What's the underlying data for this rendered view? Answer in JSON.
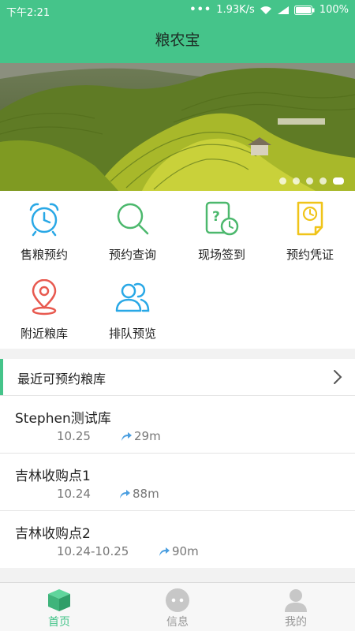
{
  "status": {
    "time": "下午2:21",
    "speed": "1.93K/s",
    "battery": "100%"
  },
  "header": {
    "title": "粮农宝"
  },
  "banner": {
    "pages": 5,
    "active_page": 5
  },
  "grid": [
    {
      "label": "售粮预约",
      "icon": "alarm-clock-icon",
      "color": "#29a8e6"
    },
    {
      "label": "预约查询",
      "icon": "search-icon",
      "color": "#4cb86d"
    },
    {
      "label": "现场签到",
      "icon": "checkin-clock-icon",
      "color": "#4cb86d"
    },
    {
      "label": "预约凭证",
      "icon": "voucher-icon",
      "color": "#f0c419"
    },
    {
      "label": "附近粮库",
      "icon": "location-pin-icon",
      "color": "#e8594f"
    },
    {
      "label": "排队预览",
      "icon": "people-icon",
      "color": "#29a8e6"
    }
  ],
  "nearby": {
    "header": "最近可预约粮库",
    "items": [
      {
        "name": "Stephen测试库",
        "date": "10.25",
        "distance": "29m"
      },
      {
        "name": "吉林收购点1",
        "date": "10.24",
        "distance": "88m"
      },
      {
        "name": "吉林收购点2",
        "date": "10.24-10.25",
        "distance": "90m"
      }
    ]
  },
  "nav": [
    {
      "label": "首页",
      "icon": "home-box-icon",
      "active": true
    },
    {
      "label": "信息",
      "icon": "message-icon",
      "active": false
    },
    {
      "label": "我的",
      "icon": "user-icon",
      "active": false
    }
  ],
  "colors": {
    "primary": "#45c48a",
    "blue": "#29a8e6",
    "green": "#4cb86d",
    "yellow": "#f0c419",
    "red": "#e8594f"
  }
}
